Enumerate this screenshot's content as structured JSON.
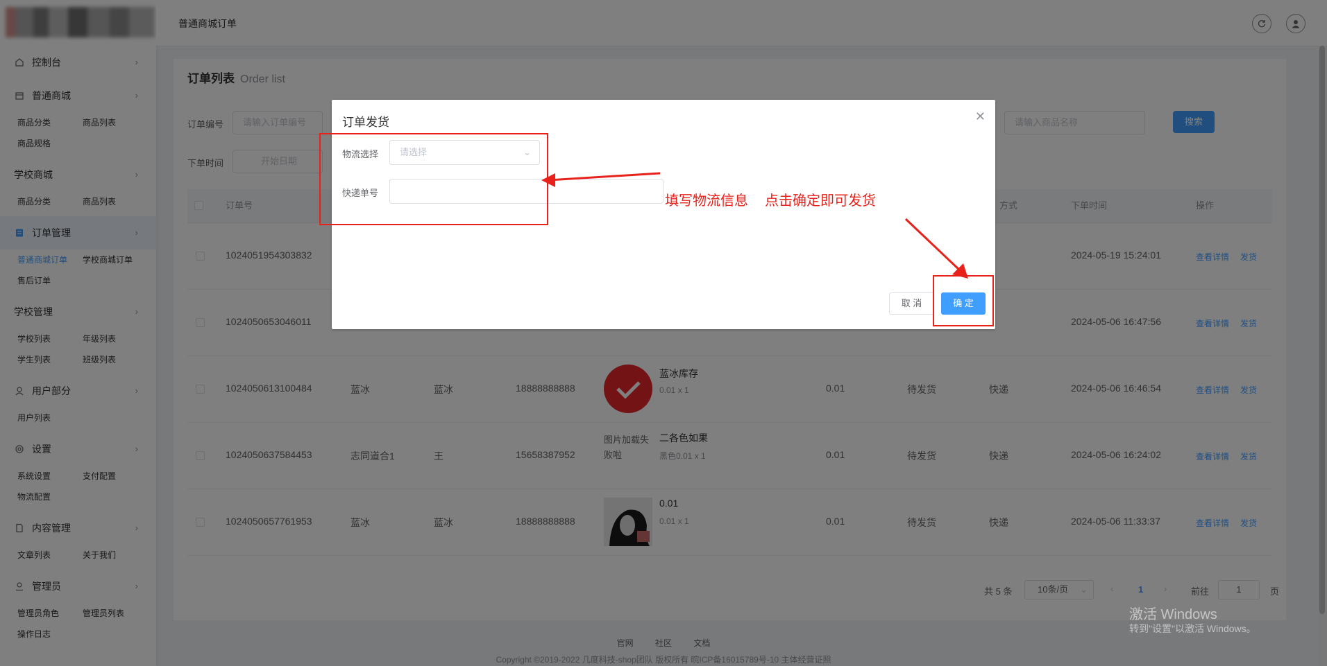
{
  "header": {
    "title": "普通商城订单"
  },
  "sidebar": {
    "groups": [
      {
        "label": "控制台",
        "icon": "home-icon",
        "items": []
      },
      {
        "label": "普通商城",
        "icon": "shop-icon",
        "items": [
          "商品分类",
          "商品列表",
          "商品规格"
        ]
      },
      {
        "label": "学校商城",
        "icon": "",
        "items": [
          "商品分类",
          "商品列表"
        ]
      },
      {
        "label": "订单管理",
        "icon": "order-icon",
        "items": [
          "普通商城订单",
          "学校商城订单",
          "售后订单"
        ]
      },
      {
        "label": "学校管理",
        "icon": "",
        "items": [
          "学校列表",
          "年级列表",
          "学生列表",
          "班级列表"
        ]
      },
      {
        "label": "用户部分",
        "icon": "user-icon",
        "items": [
          "用户列表"
        ]
      },
      {
        "label": "设置",
        "icon": "gear-icon",
        "items": [
          "系统设置",
          "支付配置",
          "物流配置"
        ]
      },
      {
        "label": "内容管理",
        "icon": "document-icon",
        "items": [
          "文章列表",
          "关于我们"
        ]
      },
      {
        "label": "管理员",
        "icon": "admin-icon",
        "items": [
          "管理员角色",
          "管理员列表",
          "操作日志"
        ]
      }
    ]
  },
  "card": {
    "title": "订单列表",
    "subtitle": "Order list",
    "filters": {
      "order_no_label": "订单编号",
      "order_no_placeholder": "请输入订单编号",
      "product_name_placeholder": "请输入商品名称",
      "search_label": "搜索",
      "time_label": "下单时间",
      "start_date_placeholder": "开始日期"
    },
    "columns": [
      "订单号",
      "方式",
      "下单时间",
      "操作"
    ],
    "rows": [
      {
        "order_no": "1024051954303832",
        "receiver": "",
        "name": "",
        "phone": "",
        "product": "",
        "spec": "",
        "amount": "",
        "status": "",
        "method": "",
        "time": "2024-05-19 15:24:01"
      },
      {
        "order_no": "1024050653046011",
        "receiver": "",
        "name": "",
        "phone": "",
        "product": "",
        "spec": "",
        "amount": "",
        "status": "",
        "method": "",
        "time": "2024-05-06 16:47:56"
      },
      {
        "order_no": "1024050613100484",
        "receiver": "蓝冰",
        "name": "蓝冰",
        "phone": "18888888888",
        "product": "蓝冰库存",
        "spec": "0.01 x 1",
        "amount": "0.01",
        "status": "待发货",
        "method": "快递",
        "time": "2024-05-06 16:46:54"
      },
      {
        "order_no": "1024050637584453",
        "receiver": "志同道合1",
        "name": "王",
        "phone": "15658387952",
        "product": "二各色如果",
        "spec": "黑色0.01 x 1",
        "amount": "0.01",
        "status": "待发货",
        "method": "快递",
        "time": "2024-05-06 16:24:02"
      },
      {
        "order_no": "1024050657761953",
        "receiver": "蓝冰",
        "name": "蓝冰",
        "phone": "18888888888",
        "product": "0.01",
        "spec": "0.01 x 1",
        "amount": "0.01",
        "status": "待发货",
        "method": "快递",
        "time": "2024-05-06 11:33:37"
      }
    ],
    "row_actions": {
      "detail": "查看详情",
      "ship": "发货"
    },
    "broken_image_alt": "图片加载失败啦",
    "pagination": {
      "total": "共 5 条",
      "page_size": "10条/页",
      "current": "1",
      "goto_label": "前往",
      "goto_value": "1",
      "page_suffix": "页"
    }
  },
  "footer": {
    "links": [
      "官网",
      "社区",
      "文档"
    ],
    "copyright": "Copyright ©2019-2022 几度科技-shop团队 版权所有 晥ICP备16015789号-10 主体经营证照"
  },
  "dialog": {
    "title": "订单发货",
    "logistics_label": "物流选择",
    "logistics_placeholder": "请选择",
    "tracking_label": "快递单号",
    "tracking_value": "",
    "cancel": "取 消",
    "confirm": "确 定"
  },
  "annotations": {
    "text1": "填写物流信息",
    "text2": "点击确定即可发货"
  },
  "watermark": {
    "line1": "激活 Windows",
    "line2": "转到\"设置\"以激活 Windows。"
  },
  "colors": {
    "primary": "#409eff",
    "annotation": "#e8221b",
    "check_red": "#e8262b"
  }
}
